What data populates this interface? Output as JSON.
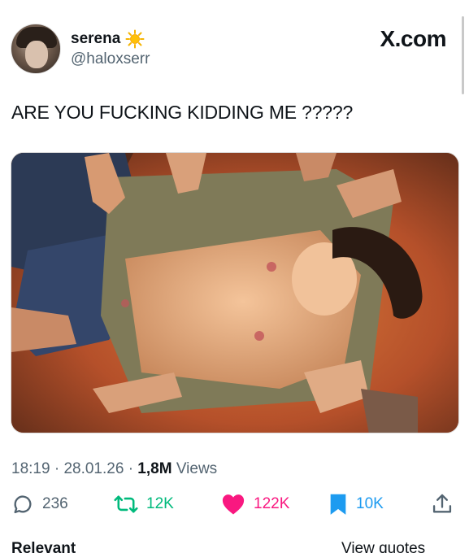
{
  "user": {
    "name": "serena",
    "handle": "@haloxserr",
    "badge_icon": "sun-emoji"
  },
  "site_label": "X.com",
  "tweet": {
    "text": "ARE YOU FUCKING KIDDING ME ?????",
    "time": "18:19",
    "date": "28.01.26",
    "views_count": "1,8M",
    "views_label": "Views",
    "media_description_icon": "photo"
  },
  "actions": {
    "replies": "236",
    "retweets": "12K",
    "likes": "122K",
    "bookmarks": "10K",
    "reply_icon": "speech-bubble-icon",
    "retweet_icon": "retweet-icon",
    "like_icon": "heart-icon",
    "bookmark_icon": "bookmark-icon",
    "share_icon": "share-icon"
  },
  "colors": {
    "retweet": "#00ba7c",
    "like": "#f91880",
    "bookmark": "#1d9bf0",
    "secondary_text": "#536471"
  },
  "bottom": {
    "left_label": "Relevant",
    "right_label": "View quotes"
  }
}
